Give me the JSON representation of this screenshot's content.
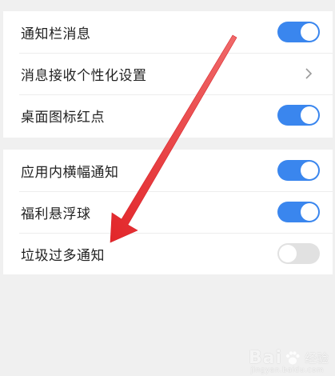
{
  "settings_group_1": {
    "items": [
      {
        "label": "通知栏消息",
        "control": "toggle",
        "state": "on"
      },
      {
        "label": "消息接收个性化设置",
        "control": "chevron"
      },
      {
        "label": "桌面图标红点",
        "control": "toggle",
        "state": "on"
      }
    ]
  },
  "settings_group_2": {
    "items": [
      {
        "label": "应用内横幅通知",
        "control": "toggle",
        "state": "on"
      },
      {
        "label": "福利悬浮球",
        "control": "toggle",
        "state": "on"
      },
      {
        "label": "垃圾过多通知",
        "control": "toggle",
        "state": "off"
      }
    ]
  },
  "colors": {
    "toggle_on": "#3a86ee",
    "toggle_off": "#e1e1e1",
    "annotation_arrow": "#e8393a"
  },
  "watermark": {
    "brand": "Bai",
    "paw": "paw-icon",
    "suffix": "经验",
    "domain": "jingyan.baidu.com"
  }
}
